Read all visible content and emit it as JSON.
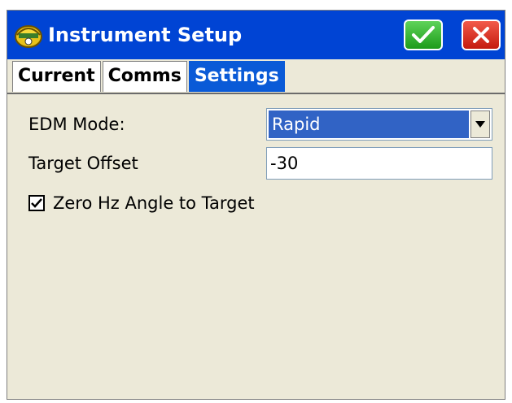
{
  "window": {
    "title": "Instrument Setup"
  },
  "titlebar": {
    "ok_icon": "checkmark-icon",
    "cancel_icon": "close-icon"
  },
  "tabs": [
    {
      "label": "Current",
      "active": false
    },
    {
      "label": "Comms",
      "active": false
    },
    {
      "label": "Settings",
      "active": true
    }
  ],
  "settings": {
    "edm_mode_label": "EDM Mode:",
    "edm_mode_value": "Rapid",
    "target_offset_label": "Target Offset",
    "target_offset_value": "-30",
    "zero_hz_label": "Zero Hz Angle to Target",
    "zero_hz_checked": true
  },
  "colors": {
    "titlebar": "#0044d4",
    "active_tab": "#0a5ad7",
    "selection": "#3163c5",
    "ok_button": "#1d9b1a",
    "cancel_button": "#c41a0e",
    "background": "#ece9d8"
  }
}
